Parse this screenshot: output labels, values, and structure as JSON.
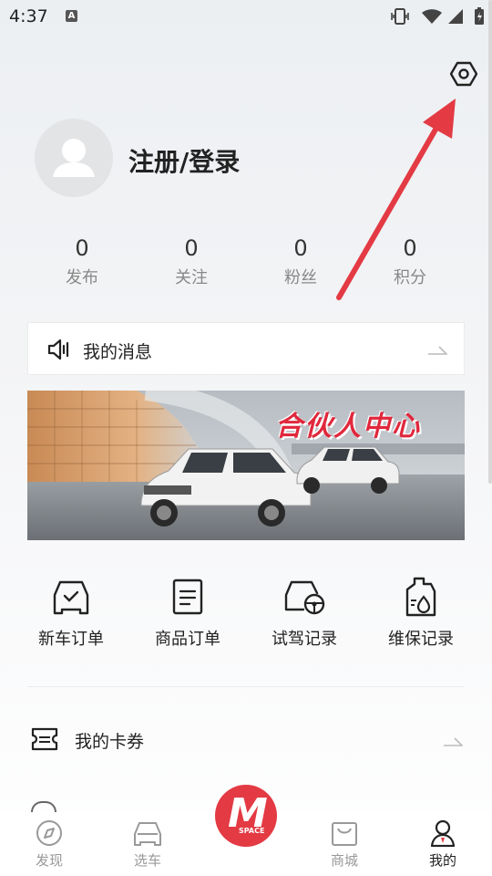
{
  "status_bar": {
    "time": "4:37",
    "notif_letter": "A"
  },
  "profile": {
    "login_label": "注册/登录"
  },
  "stats": [
    {
      "value": "0",
      "label": "发布"
    },
    {
      "value": "0",
      "label": "关注"
    },
    {
      "value": "0",
      "label": "粉丝"
    },
    {
      "value": "0",
      "label": "积分"
    }
  ],
  "messages": {
    "label": "我的消息"
  },
  "banner": {
    "title": "合伙人中心"
  },
  "orders": [
    {
      "icon": "car-check-icon",
      "label": "新车订单"
    },
    {
      "icon": "document-icon",
      "label": "商品订单"
    },
    {
      "icon": "car-steering-icon",
      "label": "试驾记录"
    },
    {
      "icon": "oil-can-icon",
      "label": "维保记录"
    }
  ],
  "cards": {
    "label": "我的卡券"
  },
  "tabs": [
    {
      "icon": "compass-icon",
      "label": "发现"
    },
    {
      "icon": "car-icon",
      "label": "选车"
    },
    {
      "icon": "m-space-logo",
      "label": ""
    },
    {
      "icon": "store-icon",
      "label": "商城"
    },
    {
      "icon": "person-icon",
      "label": "我的"
    }
  ],
  "logo": {
    "main": "M",
    "sub": "SPACE"
  },
  "colors": {
    "accent": "#e33a44",
    "banner_text": "#e0283c"
  }
}
